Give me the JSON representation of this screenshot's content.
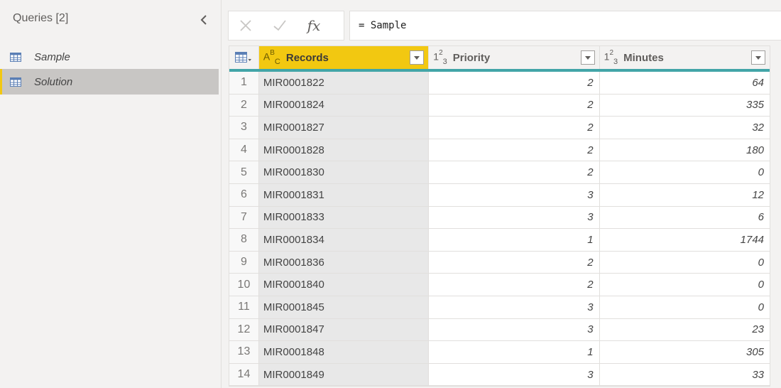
{
  "sidebar": {
    "title": "Queries [2]",
    "collapse_icon": "chevron-left-icon",
    "queries": [
      {
        "label": "Sample",
        "icon": "table-icon",
        "selected": false
      },
      {
        "label": "Solution",
        "icon": "table-icon",
        "selected": true
      }
    ]
  },
  "formula_bar": {
    "cancel_icon": "close-icon",
    "commit_icon": "check-icon",
    "fx_label": "fx",
    "formula": "= Sample"
  },
  "grid": {
    "columns": [
      {
        "name": "Records",
        "type_icon": "text-type-icon",
        "selected": true
      },
      {
        "name": "Priority",
        "type_icon": "whole-number-type-icon",
        "selected": false
      },
      {
        "name": "Minutes",
        "type_icon": "whole-number-type-icon",
        "selected": false
      }
    ],
    "rows": [
      {
        "index": "1",
        "records": "MIR0001822",
        "priority": "2",
        "minutes": "64"
      },
      {
        "index": "2",
        "records": "MIR0001824",
        "priority": "2",
        "minutes": "335"
      },
      {
        "index": "3",
        "records": "MIR0001827",
        "priority": "2",
        "minutes": "32"
      },
      {
        "index": "4",
        "records": "MIR0001828",
        "priority": "2",
        "minutes": "180"
      },
      {
        "index": "5",
        "records": "MIR0001830",
        "priority": "2",
        "minutes": "0"
      },
      {
        "index": "6",
        "records": "MIR0001831",
        "priority": "3",
        "minutes": "12"
      },
      {
        "index": "7",
        "records": "MIR0001833",
        "priority": "3",
        "minutes": "6"
      },
      {
        "index": "8",
        "records": "MIR0001834",
        "priority": "1",
        "minutes": "1744"
      },
      {
        "index": "9",
        "records": "MIR0001836",
        "priority": "2",
        "minutes": "0"
      },
      {
        "index": "10",
        "records": "MIR0001840",
        "priority": "2",
        "minutes": "0"
      },
      {
        "index": "11",
        "records": "MIR0001845",
        "priority": "3",
        "minutes": "0"
      },
      {
        "index": "12",
        "records": "MIR0001847",
        "priority": "3",
        "minutes": "23"
      },
      {
        "index": "13",
        "records": "MIR0001848",
        "priority": "1",
        "minutes": "305"
      },
      {
        "index": "14",
        "records": "MIR0001849",
        "priority": "3",
        "minutes": "33"
      }
    ]
  },
  "colors": {
    "selected_column": "#f2c811",
    "header_underline": "#42a5a8",
    "selected_query": "#c8c6c4"
  }
}
